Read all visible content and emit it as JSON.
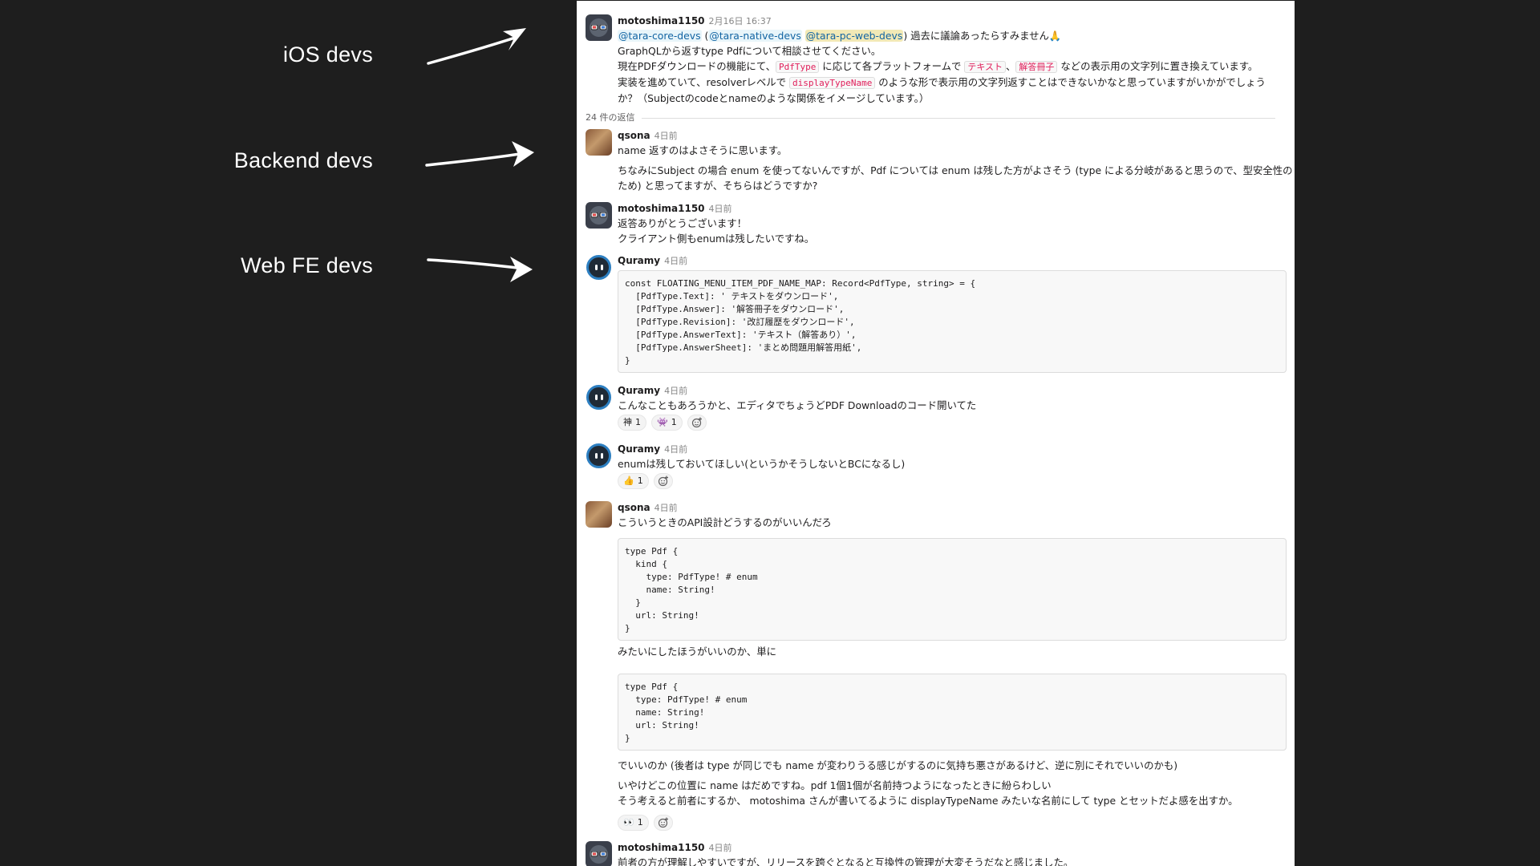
{
  "annotations": [
    {
      "label": "iOS devs"
    },
    {
      "label": "Backend devs"
    },
    {
      "label": "Web FE devs"
    }
  ],
  "thread": {
    "replies_count": "24 件の返信",
    "parent": {
      "author": "motoshima1150",
      "time": "2月16日 16:37",
      "mention_core": "@tara-core-devs",
      "paren_open": " (",
      "mention_native": "@tara-native-devs",
      "mention_web": "@tara-pc-web-devs",
      "mention_tail": ") 過去に議論あったらすみません🙏",
      "line2": "GraphQLから返すtype Pdfについて相談させてください。",
      "line3_a": "現在PDFダウンロードの機能にて、",
      "code_pdftype": "PdfType",
      "line3_b": " に応じて各プラットフォームで ",
      "code_text": "テキスト",
      "line3_c": "、",
      "code_answer": "解答冊子",
      "line3_d": " などの表示用の文字列に置き換えています。",
      "line4_a": "実装を進めていて、resolverレベルで ",
      "code_display": "displayTypeName",
      "line4_b": " のような形で表示用の文字列返すことはできないかなと思っていますがいかがでしょう",
      "line5": "か？（Subjectのcodeとnameのような関係をイメージしています。）"
    },
    "messages": [
      {
        "author": "qsona",
        "time": "4日前",
        "lines": [
          "name 返すのはよさそうに思います。",
          "ちなみにSubject の場合 enum を使ってないんですが、Pdf については enum は残した方がよさそう (type による分岐があると思うので、型安全性の",
          "ため) と思ってますが、そちらはどうですか?"
        ]
      },
      {
        "author": "motoshima1150",
        "time": "4日前",
        "lines": [
          "返答ありがとうございます！",
          "クライアント側もenumは残したいですね。"
        ]
      },
      {
        "author": "Quramy",
        "time": "4日前",
        "code": "const FLOATING_MENU_ITEM_PDF_NAME_MAP: Record<PdfType, string> = {\n  [PdfType.Text]: ' テキストをダウンロード',\n  [PdfType.Answer]: '解答冊子をダウンロード',\n  [PdfType.Revision]: '改訂履歴をダウンロード',\n  [PdfType.AnswerText]: 'テキスト（解答あり）',\n  [PdfType.AnswerSheet]: 'まとめ問題用解答用紙',\n}"
      },
      {
        "author": "Quramy",
        "time": "4日前",
        "lines": [
          "こんなこともあろうかと、エディタでちょうどPDF Downloadのコード開いてた"
        ],
        "reactions": [
          {
            "emoji": "神",
            "count": "1"
          },
          {
            "emoji": "👾",
            "count": "1"
          }
        ]
      },
      {
        "author": "Quramy",
        "time": "4日前",
        "lines": [
          "enumは残しておいてほしい(というかそうしないとBCになるし)"
        ],
        "reactions": [
          {
            "emoji": "👍",
            "count": "1"
          }
        ]
      },
      {
        "author": "qsona",
        "time": "4日前",
        "lines": [
          "こういうときのAPI設計どうするのがいいんだろ"
        ],
        "code1": "type Pdf {\n  kind {\n    type: PdfType! # enum\n    name: String!\n  }\n  url: String!\n}",
        "mid": "みたいにしたほうがいいのか、単に",
        "code2": "type Pdf {\n  type: PdfType! # enum\n  name: String!\n  url: String!\n}",
        "after": [
          "でいいのか (後者は type が同じでも name が変わりうる感じがするのに気持ち悪さがあるけど、逆に別にそれでいいのかも)",
          "いやけどこの位置に name はだめですね。pdf 1個1個が名前持つようになったときに紛らわしい",
          "そう考えると前者にするか、 motoshima さんが書いてるように displayTypeName みたいな名前にして type とセットだよ感を出すか。"
        ],
        "reactions": [
          {
            "emoji": "👀",
            "count": "1"
          }
        ]
      },
      {
        "author": "motoshima1150",
        "time": "4日前",
        "lines": [
          "前者の方が理解しやすいですが、リリースを跨ぐとなると互換性の管理が大変そうだなと感じました。"
        ]
      }
    ]
  }
}
